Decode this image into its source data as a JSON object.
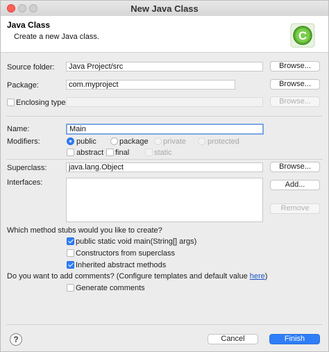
{
  "window": {
    "title": "New Java Class"
  },
  "banner": {
    "title": "Java Class",
    "description": "Create a new Java class.",
    "icon": "java-class-icon"
  },
  "source_folder": {
    "label": "Source folder:",
    "value": "Java Project/src",
    "browse_label": "Browse..."
  },
  "package": {
    "label": "Package:",
    "value": "com.myproject",
    "browse_label": "Browse..."
  },
  "enclosing_type": {
    "label": "Enclosing type:",
    "checked": false,
    "value": "",
    "browse_label": "Browse..."
  },
  "name": {
    "label": "Name:",
    "value": "Main"
  },
  "modifiers": {
    "label": "Modifiers:",
    "access": [
      {
        "label": "public",
        "selected": true,
        "enabled": true
      },
      {
        "label": "package",
        "selected": false,
        "enabled": true
      },
      {
        "label": "private",
        "selected": false,
        "enabled": false
      },
      {
        "label": "protected",
        "selected": false,
        "enabled": false
      }
    ],
    "flags": [
      {
        "label": "abstract",
        "checked": false,
        "enabled": true
      },
      {
        "label": "final",
        "checked": false,
        "enabled": true
      },
      {
        "label": "static",
        "checked": false,
        "enabled": false
      }
    ]
  },
  "superclass": {
    "label": "Superclass:",
    "value": "java.lang.Object",
    "browse_label": "Browse..."
  },
  "interfaces": {
    "label": "Interfaces:",
    "add_label": "Add...",
    "remove_label": "Remove",
    "items": []
  },
  "stubs": {
    "question": "Which method stubs would you like to create?",
    "options": [
      {
        "label": "public static void main(String[] args)",
        "checked": true
      },
      {
        "label": "Constructors from superclass",
        "checked": false
      },
      {
        "label": "Inherited abstract methods",
        "checked": true
      }
    ]
  },
  "comments": {
    "question": "Do you want to add comments? (Configure templates and default value ",
    "link": "here",
    "suffix": ")",
    "option": {
      "label": "Generate comments",
      "checked": false
    }
  },
  "footer": {
    "help": "?",
    "cancel_label": "Cancel",
    "finish_label": "Finish"
  },
  "colors": {
    "accent": "#2f7ef7",
    "close": "#ff5f57",
    "icon_green": "#5cb531"
  }
}
